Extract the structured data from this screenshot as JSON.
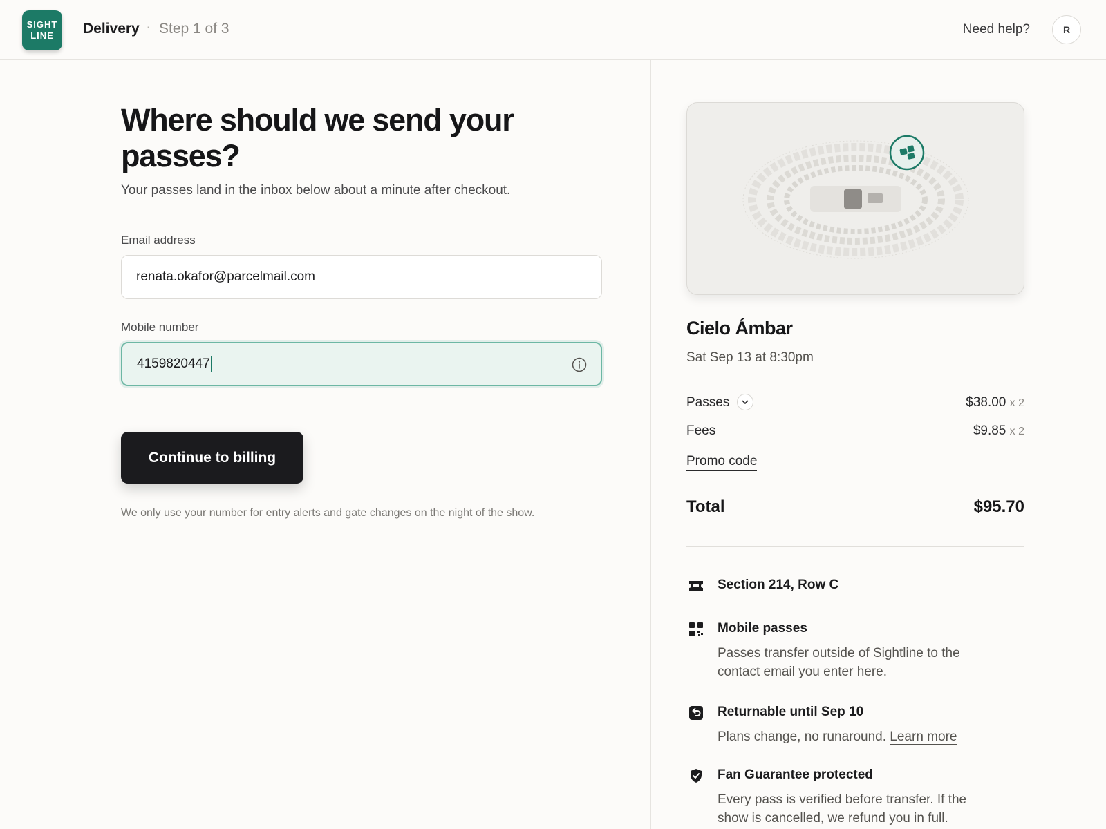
{
  "header": {
    "logo_line1": "SIGHT",
    "logo_line2": "LINE",
    "title": "Delivery",
    "separator": "·",
    "step": "Step 1 of 3",
    "help": "Need help?",
    "avatar_initial": "R"
  },
  "form": {
    "title": "Where should we send your passes?",
    "subtitle": "Your passes land in the inbox below about a minute after checkout.",
    "email_label": "Email address",
    "email_value": "renata.okafor@parcelmail.com",
    "mobile_label": "Mobile number",
    "mobile_value": "4159820447",
    "continue_label": "Continue to billing",
    "note": "We only use your number for entry alerts and gate changes on the night of the show."
  },
  "summary": {
    "event_name": "Cielo Ámbar",
    "event_date": "Sat Sep 13 at 8:30pm",
    "passes_label": "Passes",
    "passes_price": "$38.00",
    "passes_qty": "x 2",
    "fees_label": "Fees",
    "fees_price": "$9.85",
    "fees_qty": "x 2",
    "promo_label": "Promo code",
    "total_label": "Total",
    "total_value": "$95.70",
    "features": [
      {
        "icon": "ticket-icon",
        "title": "Section 214, Row C"
      },
      {
        "icon": "qr-code-icon",
        "title": "Mobile passes",
        "desc": "Passes transfer outside of Sightline to the contact email you enter here."
      },
      {
        "icon": "return-arrow-icon",
        "title": "Returnable until Sep 10",
        "desc": "Plans change, no runaround.",
        "link": "Learn more"
      },
      {
        "icon": "shield-check-icon",
        "title": "Fan Guarantee protected",
        "desc": "Every pass is verified before transfer. If the show is cancelled, we refund you in full."
      }
    ]
  },
  "colors": {
    "brand": "#1c7a66",
    "focus_bg": "#eaf4f0",
    "button": "#1b1b1e"
  }
}
